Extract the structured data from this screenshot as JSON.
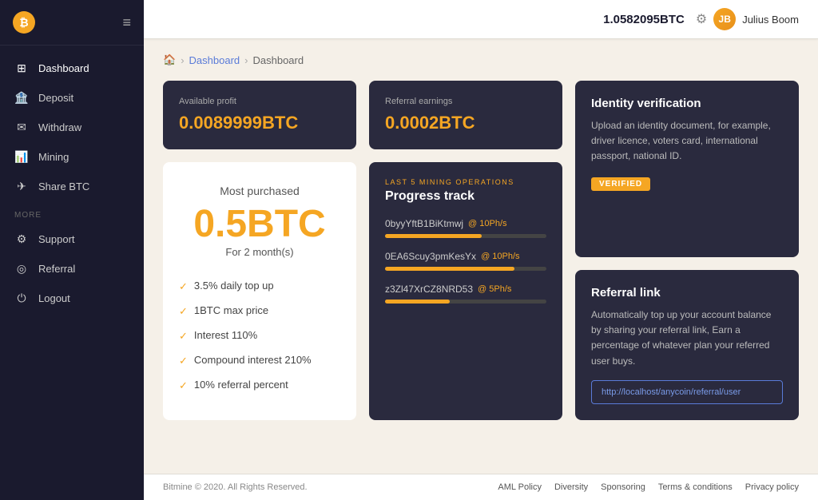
{
  "header": {
    "balance": "1.0582095BTC",
    "username": "Julius Boom",
    "initials": "JB"
  },
  "breadcrumb": {
    "home": "🏠",
    "sep1": "›",
    "link1": "Dashboard",
    "sep2": "›",
    "current": "Dashboard"
  },
  "sidebar": {
    "logo_text": "₿",
    "nav_items": [
      {
        "id": "dashboard",
        "icon": "⊞",
        "label": "Dashboard"
      },
      {
        "id": "deposit",
        "icon": "🏦",
        "label": "Deposit"
      },
      {
        "id": "withdraw",
        "icon": "✉",
        "label": "Withdraw"
      },
      {
        "id": "mining",
        "icon": "📊",
        "label": "Mining"
      },
      {
        "id": "share-btc",
        "icon": "✈",
        "label": "Share BTC"
      }
    ],
    "more_label": "MORE",
    "more_items": [
      {
        "id": "support",
        "icon": "⚙",
        "label": "Support"
      },
      {
        "id": "referral",
        "icon": "◎",
        "label": "Referral"
      },
      {
        "id": "logout",
        "icon": "⏻",
        "label": "Logout"
      }
    ]
  },
  "cards": {
    "available_profit": {
      "label": "Available profit",
      "value": "0.0089999BTC"
    },
    "referral_earnings": {
      "label": "Referral earnings",
      "value": "0.0002BTC"
    },
    "most_purchased": {
      "label": "Most purchased",
      "value": "0.5BTC",
      "sub": "For 2 month(s)",
      "features": [
        "3.5% daily top up",
        "1BTC max price",
        "Interest 110%",
        "Compound interest 210%",
        "10% referral percent"
      ]
    },
    "progress_track": {
      "sublabel": "LAST 5 MINING OPERATIONS",
      "title": "Progress track",
      "operations": [
        {
          "id": "0byyYftB1BiKtmwj",
          "rate": "@ 10Ph/s",
          "progress": 60
        },
        {
          "id": "0EA6Scuy3pmKesYx",
          "rate": "@ 10Ph/s",
          "progress": 80
        },
        {
          "id": "z3Zl47XrCZ8NRD53",
          "rate": "@ 5Ph/s",
          "progress": 40
        }
      ]
    },
    "identity": {
      "title": "Identity verification",
      "text": "Upload an identity document, for example, driver licence, voters card, international passport, national ID.",
      "badge": "VERIFIED"
    },
    "referral": {
      "title": "Referral link",
      "text": "Automatically top up your account balance by sharing your referral link, Earn a percentage of whatever plan your referred user buys.",
      "link": "http://localhost/anycoin/referral/user"
    }
  },
  "footer": {
    "copyright": "Bitmine © 2020. All Rights Reserved.",
    "links": [
      "AML Policy",
      "Diversity",
      "Sponsoring",
      "Terms & conditions",
      "Privacy policy"
    ]
  }
}
